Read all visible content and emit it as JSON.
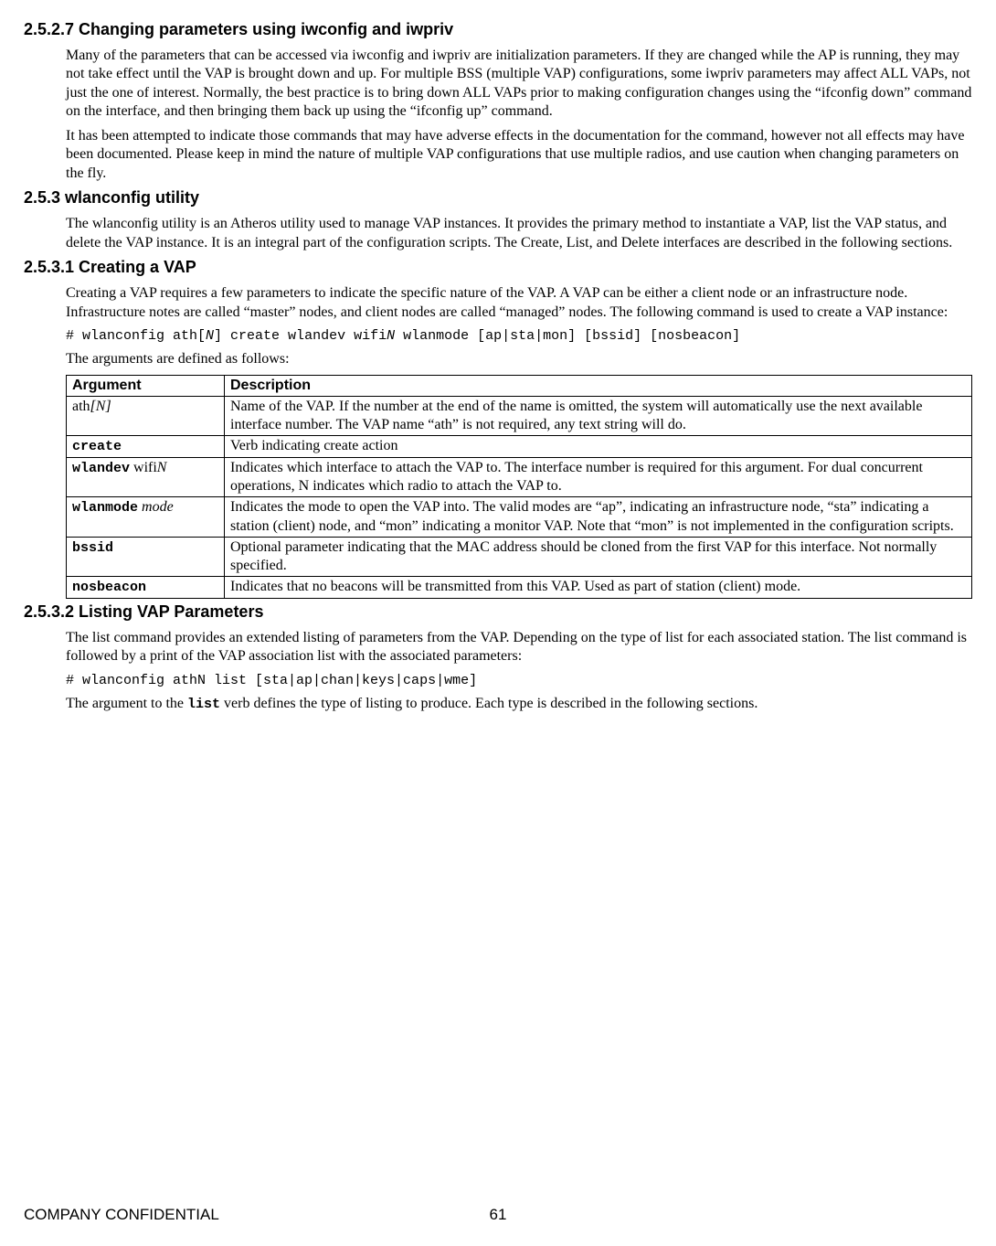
{
  "sections": {
    "s1": {
      "title": "2.5.2.7 Changing parameters using iwconfig and iwpriv",
      "p1": "Many of the parameters that can be accessed via iwconfig and iwpriv are initialization parameters. If they are changed while the AP is running, they may not take effect until the VAP is brought down and up. For multiple BSS (multiple VAP) configurations, some iwpriv parameters may affect ALL VAPs, not just the one of interest. Normally, the best practice is to bring down ALL VAPs prior to making configuration changes using the “ifconfig down” command on the interface, and then bringing them back up using the “ifconfig up” command.",
      "p2": "It has been attempted to indicate those commands that may have adverse effects in the documentation for the command, however not all effects may have been documented. Please keep in mind the nature of multiple VAP configurations that use multiple radios, and use caution when changing parameters on the fly."
    },
    "s2": {
      "title": "2.5.3 wlanconfig utility",
      "p1": "The wlanconfig utility is an Atheros utility used to manage VAP instances. It provides the primary method to instantiate a VAP, list the VAP status, and delete the VAP instance. It is an integral part of the configuration scripts. The Create, List, and Delete interfaces are described in the following sections."
    },
    "s3": {
      "title": "2.5.3.1 Creating a VAP",
      "p1": "Creating a VAP requires a few parameters to indicate the specific nature of the VAP. A VAP can be either a client node or an infrastructure node. Infrastructure notes are called “master” nodes, and client nodes are called “managed” nodes. The following command is used to create a VAP instance:",
      "cmd": "# wlanconfig ath[N] create wlandev wifiN wlanmode [ap|sta|mon] [bssid] [nosbeacon]",
      "cmd_parts": {
        "a": "# wlanconfig ath[",
        "b": "N",
        "c": "] create wlandev wifi",
        "d": "N",
        "e": " wlanmode [ap|sta|mon] [bssid] [nosbeacon]"
      },
      "p2": "The arguments are defined as follows:",
      "tbl": {
        "h1": "Argument",
        "h2": "Description",
        "rows": [
          {
            "arg_html": "ath<span class=\"it\">[N]</span>",
            "desc": "Name of the VAP. If the number at the end of the name is omitted, the system will automatically use the next available interface number. The VAP name “ath” is not required, any text string will do."
          },
          {
            "arg_html": "<span class=\"mono bold\">create</span>",
            "desc": "Verb indicating create action"
          },
          {
            "arg_html": "<span class=\"mono bold\">wlandev</span> wifi<span class=\"it\">N</span>",
            "desc": "Indicates which interface to attach the VAP to. The interface number is required for this argument. For dual concurrent operations, N indicates which radio to attach the VAP to."
          },
          {
            "arg_html": "<span class=\"mono bold\">wlanmode</span> <span class=\"it\">mode</span>",
            "desc": "Indicates the mode to open the VAP into. The valid modes are “ap”, indicating an infrastructure node, “sta” indicating a station (client) node, and “mon” indicating a monitor VAP. Note that “mon” is not implemented in the configuration scripts."
          },
          {
            "arg_html": "<span class=\"mono bold\">bssid</span>",
            "desc": "Optional parameter indicating that the MAC address should be cloned from the first VAP for this interface. Not normally specified."
          },
          {
            "arg_html": "<span class=\"mono bold\">nosbeacon</span>",
            "desc": "Indicates that no beacons will be transmitted from this VAP. Used as part of station (client) mode."
          }
        ]
      }
    },
    "s4": {
      "title": "2.5.3.2 Listing VAP Parameters",
      "p1": "The list command provides an extended listing of parameters from the VAP. Depending on the type of list for each associated station. The list command is followed by a print of the VAP association list with the associated parameters:",
      "cmd": "# wlanconfig athN list [sta|ap|chan|keys|caps|wme]",
      "p2_a": "The argument to the ",
      "p2_b": "list",
      "p2_c": " verb defines the type of listing to produce. Each type is described in the following sections."
    }
  },
  "footer": {
    "left": "COMPANY CONFIDENTIAL",
    "page": "61"
  }
}
